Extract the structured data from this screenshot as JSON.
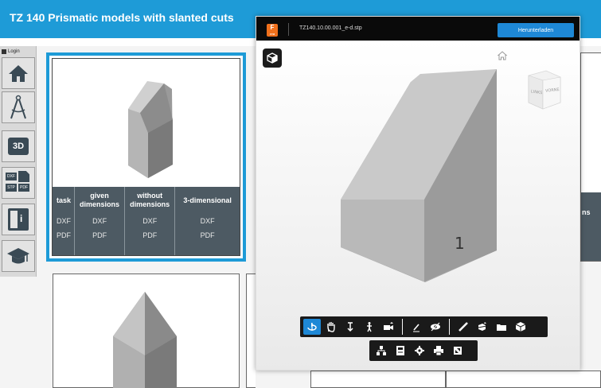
{
  "header": {
    "title": "TZ 140 Prismatic models with slanted cuts"
  },
  "sidebar": {
    "login_label": "Login",
    "items": [
      {
        "name": "home",
        "icon": "home-icon"
      },
      {
        "name": "compass",
        "icon": "compass-icon"
      },
      {
        "name": "3d",
        "label": "3D",
        "icon": "3d-icon"
      },
      {
        "name": "files",
        "labels": [
          "DXF",
          "STP",
          "PDF"
        ],
        "icon": "file-formats-icon"
      },
      {
        "name": "book",
        "label": "i",
        "icon": "book-info-icon"
      },
      {
        "name": "education",
        "icon": "graduation-cap-icon"
      }
    ]
  },
  "card": {
    "columns": [
      {
        "header": "task",
        "items": [
          "DXF",
          "PDF"
        ]
      },
      {
        "header": "given dimensions",
        "items": [
          "DXF",
          "PDF"
        ]
      },
      {
        "header": "without dimensions",
        "items": [
          "DXF",
          "PDF"
        ]
      },
      {
        "header": "3-dimensional",
        "items": [
          "DXF",
          "PDF"
        ]
      }
    ]
  },
  "partial_card": {
    "header_fragment": "ns"
  },
  "viewer": {
    "logo_letter": "F",
    "logo_sub": "FTM",
    "file_name": "TZ140.10.00.001_e-d.stp",
    "download_label": "Herunterladen",
    "part_label": "1",
    "nav_cube": {
      "left_face": "LINKS",
      "front_face": "VORNE"
    },
    "toolbar_row1": [
      "rotate-icon",
      "pan-icon",
      "zoom-icon",
      "walk-icon",
      "camera-icon",
      "markup-icon",
      "visibility-icon",
      "measure-icon",
      "section-icon",
      "explode-icon",
      "view-cube-icon"
    ],
    "toolbar_row2": [
      "model-tree-icon",
      "properties-icon",
      "settings-icon",
      "print-icon",
      "fullscreen-icon"
    ]
  },
  "colors": {
    "accent": "#1e9bd7",
    "download": "#1e88d6",
    "table": "#4d5a63",
    "logo": "#f0701c"
  }
}
